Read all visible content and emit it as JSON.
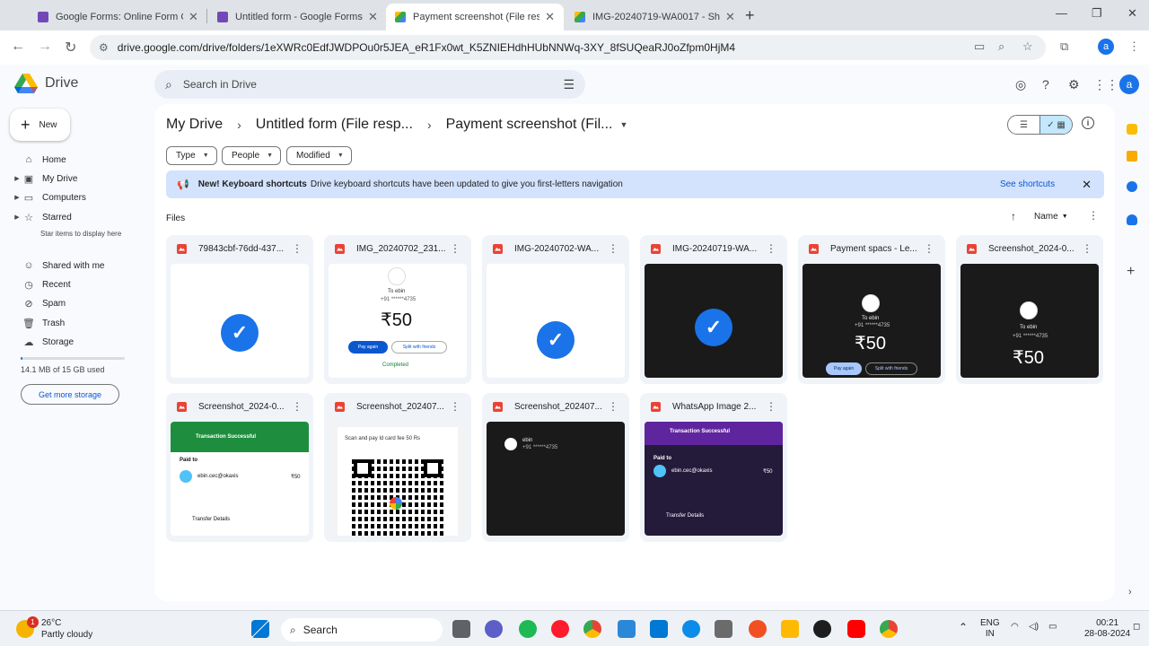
{
  "browser": {
    "tabs": [
      {
        "title": "Google Forms: Online Form Cre",
        "color": "#7248b9",
        "active": false
      },
      {
        "title": "Untitled form - Google Forms",
        "color": "#7248b9",
        "active": false
      },
      {
        "title": "Payment screenshot (File respo",
        "color": "#34a853",
        "active": true
      },
      {
        "title": "IMG-20240719-WA0017 - Shifa",
        "color": "#34a853",
        "active": false
      }
    ],
    "url": "drive.google.com/drive/folders/1eXWRc0EdfJWDPOu0r5JEA_eR1Fx0wt_K5ZNIEHdhHUbNNWq-3XY_8fSUQeaRJ0oZfpm0HjM4",
    "profile_initial": "a"
  },
  "drive": {
    "logo_text": "Drive",
    "search_placeholder": "Search in Drive",
    "avatar_initial": "a",
    "new_label": "New",
    "nav": {
      "home": "Home",
      "my_drive": "My Drive",
      "computers": "Computers",
      "starred": "Starred",
      "starred_sub": "Star items to display here",
      "shared": "Shared with me",
      "recent": "Recent",
      "spam": "Spam",
      "trash": "Trash",
      "storage": "Storage"
    },
    "storage_used_fraction": 0.01,
    "storage_text": "14.1 MB of 15 GB used",
    "get_storage": "Get more storage",
    "breadcrumb": [
      "My Drive",
      "Untitled form (File resp...",
      "Payment screenshot (Fil..."
    ],
    "filters": [
      "Type",
      "People",
      "Modified"
    ],
    "banner": {
      "bold": "New! Keyboard shortcuts",
      "message": "Drive keyboard shortcuts have been updated to give you first-letters navigation",
      "link": "See shortcuts"
    },
    "files_label": "Files",
    "sort_label": "Name",
    "files": [
      "79843cbf-76dd-437...",
      "IMG_20240702_231...",
      "IMG-20240702-WA...",
      "IMG-20240719-WA...",
      "Payment spacs - Le...",
      "Screenshot_2024-0...",
      "Screenshot_2024-0...",
      "Screenshot_202407...",
      "Screenshot_202407...",
      "WhatsApp Image 2..."
    ],
    "thumbs": {
      "to_ebin": "To ebin",
      "phone": "+91 ******4735",
      "amount": "₹50",
      "pay_again": "Pay again",
      "split": "Split with friends",
      "completed": "Completed",
      "txn_success": "Transaction Successful",
      "paid_to": "Paid to",
      "payee": "ebin.cec@okaxis",
      "amt_small": "₹50",
      "transfer_details": "Transfer Details",
      "scan_text": "Scan and pay Id card fee 50 Rs",
      "ebin": "ebin"
    }
  },
  "taskbar": {
    "temp": "26°C",
    "weather": "Partly cloudy",
    "weather_badge": "1",
    "search": "Search",
    "lang1": "ENG",
    "lang2": "IN",
    "time": "00:21",
    "date": "28-08-2024"
  }
}
